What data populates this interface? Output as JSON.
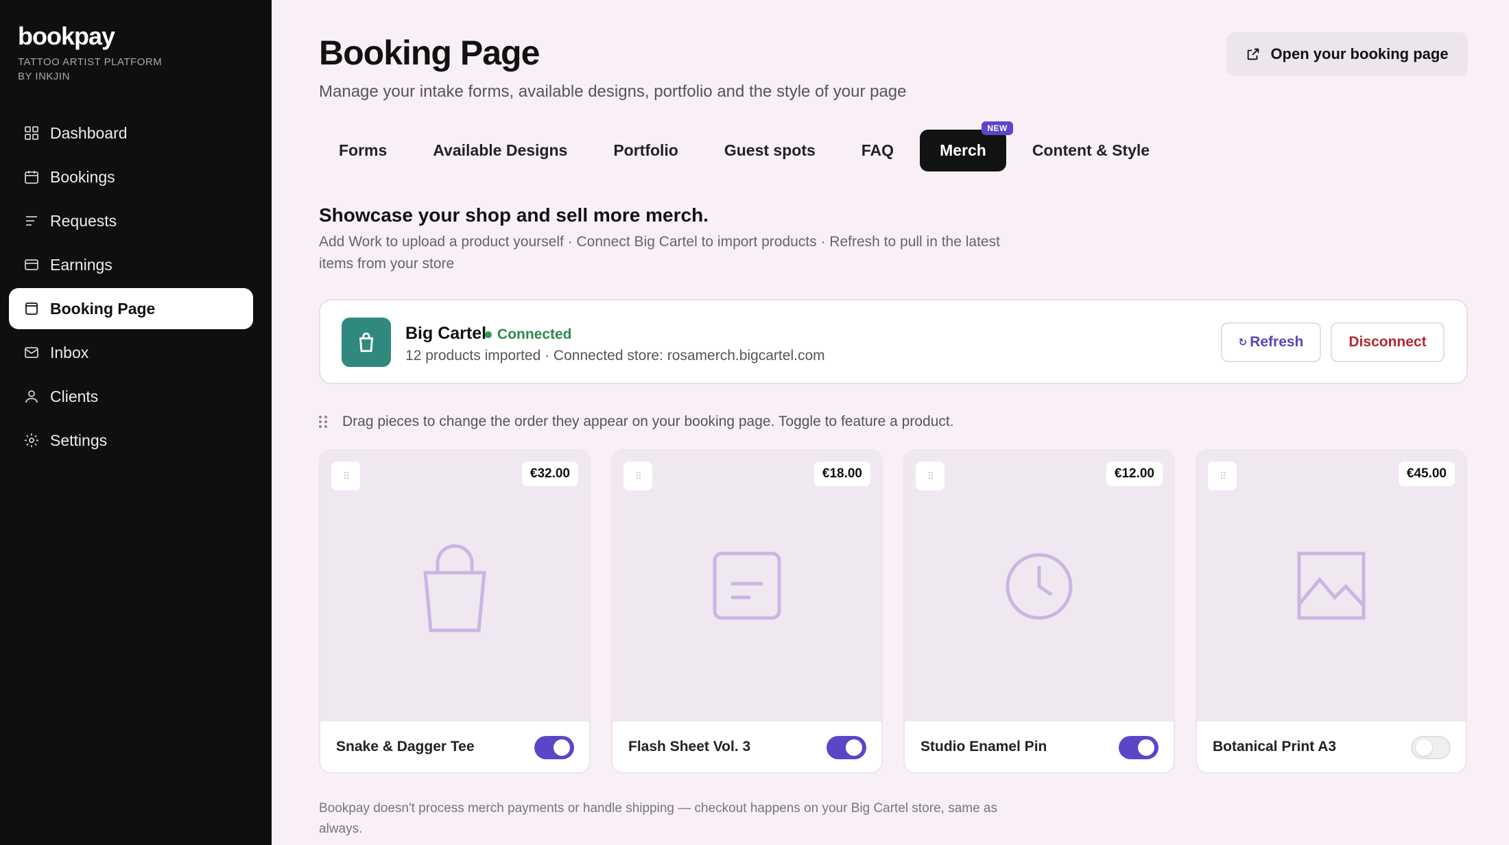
{
  "brand": {
    "logo": "bookpay",
    "tagline_line1": "TATTOO ARTIST PLATFORM",
    "tagline_line2": "BY INKJIN"
  },
  "sidebar": {
    "items": [
      {
        "label": "Dashboard",
        "icon": "grid-icon"
      },
      {
        "label": "Bookings",
        "icon": "calendar-icon"
      },
      {
        "label": "Requests",
        "icon": "list-icon"
      },
      {
        "label": "Earnings",
        "icon": "card-icon"
      },
      {
        "label": "Booking Page",
        "icon": "page-icon",
        "active": true
      },
      {
        "label": "Inbox",
        "icon": "mail-icon"
      },
      {
        "label": "Clients",
        "icon": "user-icon"
      },
      {
        "label": "Settings",
        "icon": "gear-icon"
      }
    ]
  },
  "header": {
    "title": "Booking Page",
    "subtitle": "Manage your intake forms, available designs, portfolio and the style of your page",
    "open_button": "Open your booking page"
  },
  "tabs": [
    {
      "label": "Forms"
    },
    {
      "label": "Available Designs"
    },
    {
      "label": "Portfolio"
    },
    {
      "label": "Guest spots"
    },
    {
      "label": "FAQ"
    },
    {
      "label": "Merch",
      "active": true,
      "badge": "NEW"
    },
    {
      "label": "Content & Style"
    }
  ],
  "section": {
    "title": "Showcase your shop and sell more merch.",
    "description": "Add Work to upload a product yourself · Connect Big Cartel to import products · Refresh to pull in the latest items from your store"
  },
  "connection": {
    "name": "Big Cartel",
    "status": "Connected",
    "meta": "12 products imported · Connected store: rosamerch.bigcartel.com",
    "refresh_label": "Refresh",
    "disconnect_label": "Disconnect",
    "status_color": "#2f8a4f"
  },
  "drag_hint": "Drag pieces to change the order they appear on your booking page. Toggle to feature a product.",
  "products": [
    {
      "name": "Snake & Dagger Tee",
      "price": "€32.00",
      "featured": true,
      "icon": "bag-icon"
    },
    {
      "name": "Flash Sheet Vol. 3",
      "price": "€18.00",
      "featured": true,
      "icon": "document-icon"
    },
    {
      "name": "Studio Enamel Pin",
      "price": "€12.00",
      "featured": true,
      "icon": "clock-icon"
    },
    {
      "name": "Botanical Print A3",
      "price": "€45.00",
      "featured": false,
      "icon": "image-icon"
    }
  ],
  "footnote": "Bookpay doesn't process merch payments or handle shipping — checkout happens on your Big Cartel store, same as always.",
  "colors": {
    "accent": "#5d45c8",
    "sidebar_bg": "#0f0f0f",
    "page_bg": "#f8eff7",
    "danger": "#b3272d"
  }
}
